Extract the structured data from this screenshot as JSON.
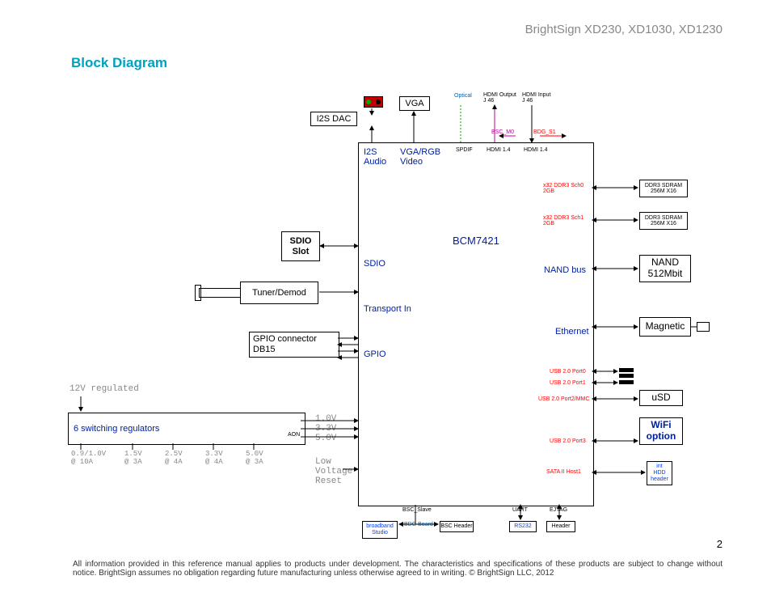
{
  "header": "BrightSign XD230, XD1030, XD1230",
  "title": "Block Diagram",
  "pageNumber": "2",
  "footer": "All information provided in this reference manual applies to products under development. The characteristics and specifications of these products are subject to change without notice. BrightSign assumes no obligation regarding future manufacturing unless otherwise agreed to in writing. © BrightSign LLC, 2012",
  "chip": "BCM7421",
  "top": {
    "i2sDac": "I2S DAC",
    "vga": "VGA",
    "optical": "Optical",
    "hdmiOut": "HDMI Output\nJ 46",
    "hdmiIn": "HDMI Input\nJ 46",
    "bscm0": "BSC_M0",
    "bdgs1": "BDG_S1"
  },
  "ports": {
    "i2sAudio": "I2S\nAudio",
    "vgaRgb": "VGA/RGB\nVideo",
    "spdif": "SPDIF",
    "hdmi14a": "HDMI 1.4",
    "hdmi14b": "HDMI 1.4",
    "sdio": "SDIO",
    "transportIn": "Transport In",
    "gpio": "GPIO",
    "nandBus": "NAND bus",
    "ethernet": "Ethernet",
    "ddr0": "x32 DDR3 Sch0\n2GB",
    "ddr1": "x32 DDR3 Sch1\n2GB",
    "usb0": "USB 2.0 Port0",
    "usb1": "USB 2.0 Port1",
    "usb2": "USB 2.0 Port2/MMC",
    "usb3": "USB 2.0 Port3",
    "sata": "SATA II Host1",
    "uart": "UART",
    "ejtag": "EJTAG",
    "bscSlave": "BSC_Slave"
  },
  "left": {
    "sdioSlot": "SDIO\nSlot",
    "tuner": "Tuner/Demod",
    "gpioConn": "GPIO connector\nDB15"
  },
  "right": {
    "ddr0b": "DDR3 SDRAM\n256M X16",
    "ddr1b": "DDR3 SDRAM\n256M X16",
    "nand": "NAND\n512Mbit",
    "magnetic": "Magnetic",
    "usd": "uSD",
    "wifi": "WiFi\noption",
    "hdd": "int\nHDD\nheader"
  },
  "bottom": {
    "rs232": "RS232",
    "bscHeader": "Header",
    "bbStudio": "broadband\nStudio",
    "bdgBoard": "BDG Board",
    "bscHdr2": "BSC Header"
  },
  "power": {
    "reg12": "12V regulated",
    "switchers": "6 switching regulators",
    "aon": "AON",
    "r1": "0.9/1.0V\n@ 10A",
    "r2": "1.5V\n@ 3A",
    "r3": "2.5V\n@ 4A",
    "r4": "3.3V\n@ 4A",
    "r5": "5.0V\n@ 3A",
    "volts": "1.0V\n3.3V\n5.0V",
    "lvr": "Low\nVoltage\nReset"
  }
}
